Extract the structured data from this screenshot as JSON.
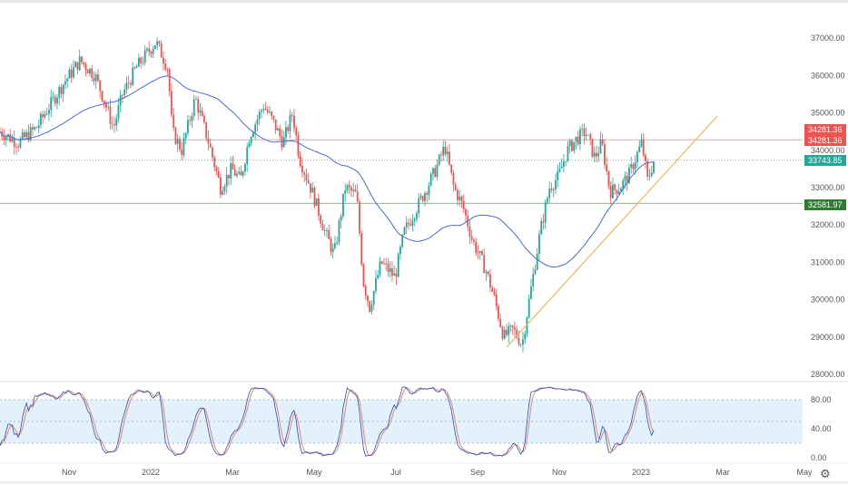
{
  "chart_data": {
    "type": "candlestick",
    "title": "",
    "time_unit": "months since 2021-10-01",
    "key_points": [
      [
        -0.69,
        34500
      ],
      [
        -0.24,
        34200
      ],
      [
        0.2,
        34600
      ],
      [
        0.53,
        35200
      ],
      [
        0.87,
        35800
      ],
      [
        1.27,
        36400
      ],
      [
        1.64,
        36000
      ],
      [
        1.87,
        35300
      ],
      [
        2.09,
        34600
      ],
      [
        2.31,
        35500
      ],
      [
        2.64,
        36200
      ],
      [
        2.98,
        36700
      ],
      [
        3.13,
        36900
      ],
      [
        3.42,
        36200
      ],
      [
        3.53,
        34500
      ],
      [
        3.76,
        34000
      ],
      [
        4.09,
        35400
      ],
      [
        4.42,
        34200
      ],
      [
        4.71,
        33000
      ],
      [
        4.98,
        33500
      ],
      [
        5.2,
        33200
      ],
      [
        5.42,
        34400
      ],
      [
        5.76,
        35200
      ],
      [
        5.98,
        34800
      ],
      [
        6.24,
        34200
      ],
      [
        6.47,
        35000
      ],
      [
        6.64,
        33800
      ],
      [
        6.98,
        32800
      ],
      [
        7.27,
        31800
      ],
      [
        7.49,
        31200
      ],
      [
        7.76,
        33000
      ],
      [
        8.04,
        32800
      ],
      [
        8.2,
        30500
      ],
      [
        8.36,
        29800
      ],
      [
        8.64,
        31000
      ],
      [
        8.98,
        30600
      ],
      [
        9.2,
        31800
      ],
      [
        9.53,
        32500
      ],
      [
        9.76,
        33000
      ],
      [
        9.98,
        33500
      ],
      [
        10.2,
        34100
      ],
      [
        10.42,
        33000
      ],
      [
        10.64,
        32500
      ],
      [
        10.87,
        31600
      ],
      [
        11.2,
        30800
      ],
      [
        11.42,
        30000
      ],
      [
        11.64,
        29000
      ],
      [
        11.87,
        29200
      ],
      [
        12.09,
        28800
      ],
      [
        12.31,
        30300
      ],
      [
        12.53,
        31800
      ],
      [
        12.76,
        33000
      ],
      [
        12.98,
        33300
      ],
      [
        13.2,
        34000
      ],
      [
        13.42,
        34300
      ],
      [
        13.64,
        34500
      ],
      [
        13.87,
        33800
      ],
      [
        14.04,
        34200
      ],
      [
        14.24,
        32900
      ],
      [
        14.47,
        33000
      ],
      [
        14.69,
        33300
      ],
      [
        14.87,
        33800
      ],
      [
        15.02,
        34200
      ],
      [
        15.16,
        33200
      ],
      [
        15.31,
        33700
      ]
    ],
    "moving_average": {
      "type": "SMA",
      "period": 50,
      "color": "#4a6bd6"
    },
    "x_ticks": [
      "Nov",
      "2022",
      "Mar",
      "May",
      "Jul",
      "Sep",
      "Nov",
      "2023",
      "Mar",
      "May"
    ],
    "x_tick_values": [
      1,
      3,
      5,
      7,
      9,
      11,
      13,
      15,
      17,
      19
    ],
    "y_ticks": [
      "37000.00",
      "36000.00",
      "35000.00",
      "34000.00",
      "33000.00",
      "32000.00",
      "31000.00",
      "30000.00",
      "29000.00",
      "28000.00"
    ],
    "ylim": [
      27980,
      37700
    ],
    "xlim": [
      -0.69,
      19.8
    ],
    "levels": [
      {
        "label": "34281.36",
        "value": 34281.36,
        "color": "#ef5350"
      },
      {
        "label": "34281.36",
        "value": 34281.36,
        "color": "#ef5350"
      },
      {
        "label": "33743.85",
        "value": 33743.85,
        "color": "#26a69a"
      },
      {
        "label": "32581.97",
        "value": 32581.97,
        "color": "#2e7d32"
      }
    ],
    "trendline": {
      "from": [
        11.71,
        28730
      ],
      "to": [
        16.87,
        34920
      ],
      "color": "#f0b860"
    },
    "up_color": "#26a69a",
    "down_color": "#ef5350",
    "oscillator": {
      "type": "stochastic",
      "ylim": [
        0,
        100
      ],
      "y_ticks": [
        "80.00",
        "40.00",
        "0.00"
      ],
      "y_tick_values": [
        80,
        40,
        0
      ],
      "band": [
        20,
        80
      ],
      "guides": [
        80,
        50,
        20
      ],
      "k_color": "#2a4fb0",
      "d_color": "#e0887a",
      "band_color": "#e3f1fc"
    }
  },
  "settings_icon": "gear-icon"
}
